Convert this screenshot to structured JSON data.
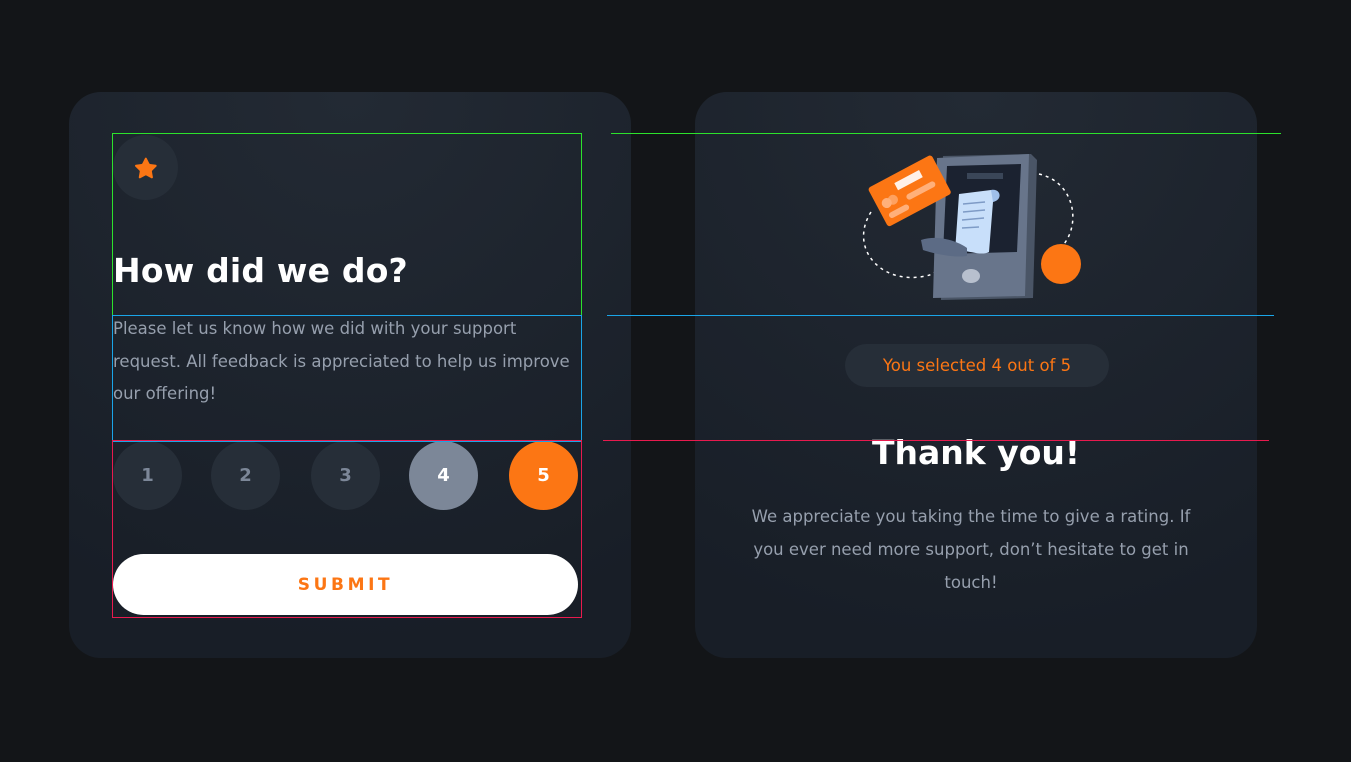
{
  "rating_card": {
    "title": "How did we do?",
    "description": "Please let us know how we did with your support request. All feedback is appreciated to help us improve our offering!",
    "ratings": [
      "1",
      "2",
      "3",
      "4",
      "5"
    ],
    "hovered": "4",
    "selected": "5",
    "submit_label": "SUBMIT",
    "icon": "star-icon"
  },
  "thank_you_card": {
    "illustration": "phone-receipt-card-illustration",
    "selection_text": "You selected 4 out of 5",
    "title": "Thank you!",
    "message": "We appreciate you taking the time to give a rating. If you ever need more support, don’t hesitate to get in touch!"
  },
  "colors": {
    "background": "#131518",
    "card": "#1E2530",
    "accent": "#FC7614",
    "muted": "#969FAD",
    "button_inactive": "#262E38",
    "button_hover": "#7C8798",
    "guide_green": "#2CE22C",
    "guide_blue": "#1AA5E8",
    "guide_red": "#E81A4E"
  }
}
